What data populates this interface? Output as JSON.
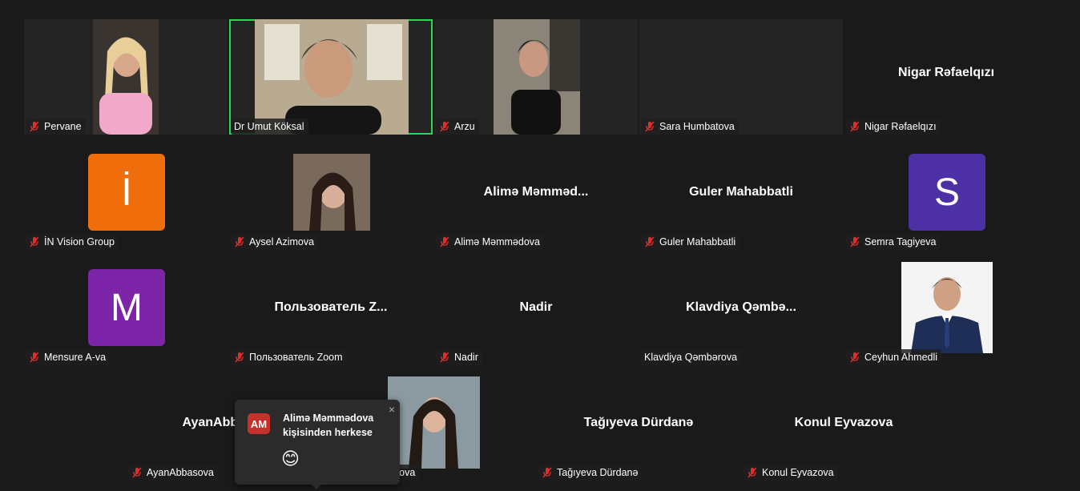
{
  "participants": {
    "pervane": {
      "name": "Pervane"
    },
    "umut": {
      "name": "Dr Umut Köksal"
    },
    "arzu": {
      "name": "Arzu"
    },
    "sara": {
      "name": "Sara Humbatova"
    },
    "nigar": {
      "display": "Nigar Rəfaelqızı",
      "name": "Nigar Rəfaelqızı"
    },
    "invision": {
      "initial": "İ",
      "name": "İN Vision Group",
      "color": "#f06d0c"
    },
    "aysel": {
      "name": "Aysel Azimova"
    },
    "alime": {
      "display": "Alimə  Məmməd...",
      "name": "Alimə Məmmədova"
    },
    "guler": {
      "display": "Guler Mahabbatli",
      "name": "Guler Mahabbatli"
    },
    "semra": {
      "initial": "S",
      "name": "Semra Tagiyeva",
      "color": "#4d2fa6"
    },
    "mensure": {
      "initial": "M",
      "name": "Mensure A-va",
      "color": "#7c25a8"
    },
    "zoomuser": {
      "display": "Пользователь  Z...",
      "name": "Пользователь Zoom"
    },
    "nadir": {
      "display": "Nadir",
      "name": "Nadir"
    },
    "klavdiya": {
      "display": "Klavdiya  Qəmbə...",
      "name": "Klavdiya Qəmbərova"
    },
    "ceyhun": {
      "name": "Ceyhun Ahmedli"
    },
    "ayan": {
      "display": "AyanAbbasova",
      "name": "AyanAbbasova"
    },
    "hidden": {
      "name_partial": "rova"
    },
    "durdane": {
      "display": "Tağıyeva Dürdanə",
      "name": "Tağıyeva Dürdanə"
    },
    "konul": {
      "display": "Konul Eyvazova",
      "name": "Konul Eyvazova"
    }
  },
  "reaction_popup": {
    "initials": "AM",
    "title": "Alimə Məmmədova",
    "subtitle": "kişisinden herkese",
    "emoji": "😊",
    "close": "×"
  },
  "colors": {
    "active_border": "#23d959",
    "muted_mic": "#e02f2f"
  }
}
